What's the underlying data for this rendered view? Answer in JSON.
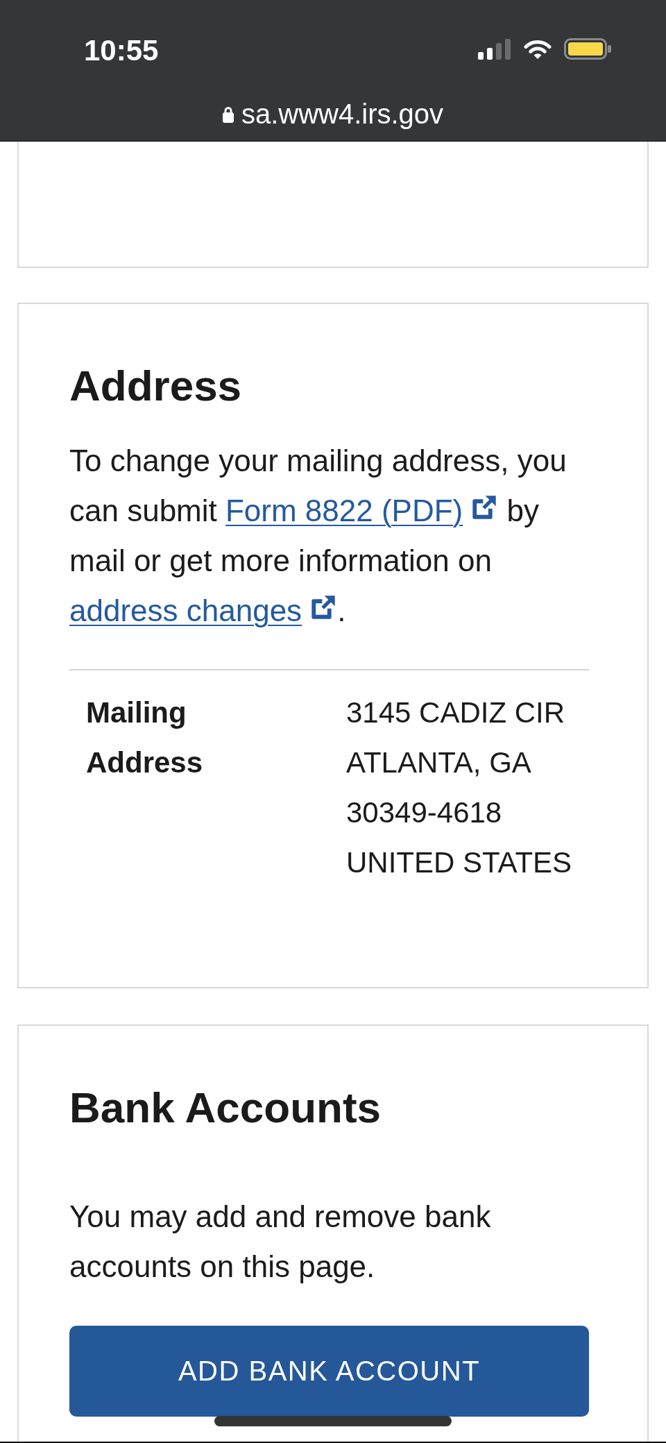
{
  "status_bar": {
    "time": "10:55"
  },
  "address_bar": {
    "url": "sa.www4.irs.gov",
    "secure": true
  },
  "cards": [
    {
      "kind": "partial"
    },
    {
      "kind": "details",
      "title": "Address",
      "intro": [
        {
          "kind": "text",
          "text": "To change your mailing address, you can submit "
        },
        {
          "kind": "link",
          "text": "Form 8822 (PDF)",
          "external": true
        },
        {
          "kind": "text",
          "text": " by mail or get more information on "
        },
        {
          "kind": "link",
          "text": "address changes",
          "external": true
        },
        {
          "kind": "text",
          "text": "."
        }
      ],
      "rows": [
        {
          "label": "Mailing Address",
          "value_lines": [
            "3145 CADIZ CIR",
            "ATLANTA, GA",
            "30349-4618",
            "UNITED STATES"
          ]
        }
      ]
    },
    {
      "kind": "action",
      "title": "Bank Accounts",
      "text": "You may add and remove bank accounts on this page.",
      "button": "ADD BANK ACCOUNT"
    }
  ]
}
